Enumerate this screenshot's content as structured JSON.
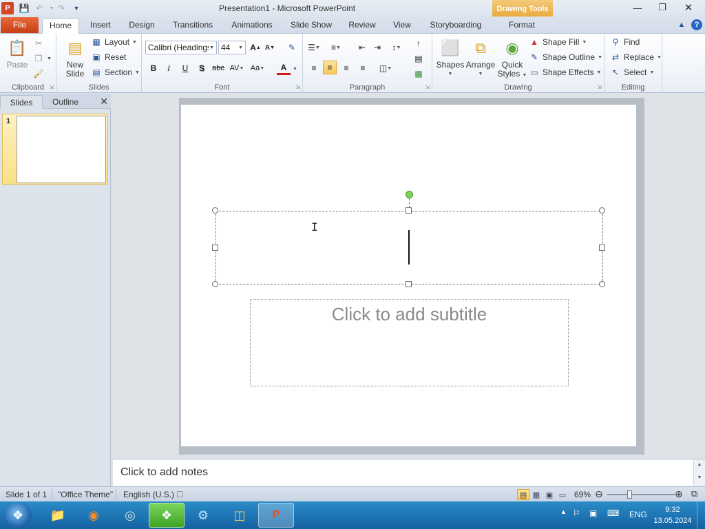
{
  "app": {
    "title": "Presentation1 - Microsoft PowerPoint",
    "context_tab": "Drawing Tools",
    "icon_letter": "P"
  },
  "tabs": {
    "file": "File",
    "items": [
      "Home",
      "Insert",
      "Design",
      "Transitions",
      "Animations",
      "Slide Show",
      "Review",
      "View",
      "Storyboarding",
      "Format"
    ],
    "active": "Home"
  },
  "ribbon": {
    "clipboard": {
      "label": "Clipboard",
      "paste": "Paste"
    },
    "slides": {
      "label": "Slides",
      "new_slide_1": "New",
      "new_slide_2": "Slide",
      "layout": "Layout",
      "reset": "Reset",
      "section": "Section"
    },
    "font": {
      "label": "Font",
      "font_name": "Calibri (Headings)",
      "font_size": "44"
    },
    "paragraph": {
      "label": "Paragraph"
    },
    "drawing": {
      "label": "Drawing",
      "shapes": "Shapes",
      "arrange": "Arrange",
      "quick_styles_1": "Quick",
      "quick_styles_2": "Styles",
      "shape_fill": "Shape Fill",
      "shape_outline": "Shape Outline",
      "shape_effects": "Shape Effects"
    },
    "editing": {
      "label": "Editing",
      "find": "Find",
      "replace": "Replace",
      "select": "Select"
    }
  },
  "left_pane": {
    "tab_slides": "Slides",
    "tab_outline": "Outline",
    "slide_number": "1"
  },
  "slide": {
    "subtitle_placeholder": "Click to add subtitle"
  },
  "notes": {
    "placeholder": "Click to add notes"
  },
  "status": {
    "slide_info": "Slide 1 of 1",
    "theme": "\"Office Theme\"",
    "language": "English (U.S.)",
    "zoom": "69%",
    "zoom_fraction": 0.69
  },
  "taskbar": {
    "lang": "ENG",
    "time": "9:32",
    "date": "13.05.2024"
  },
  "colors": {
    "file_tab": "#d24726",
    "drawing_tools": "#e8a93a",
    "taskbar": "#1561a1"
  }
}
